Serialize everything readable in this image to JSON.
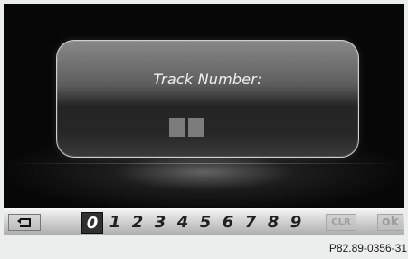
{
  "dialog": {
    "title": "Track Number:"
  },
  "keypad": {
    "selected_digit": "0",
    "digits": [
      "0",
      "1",
      "2",
      "3",
      "4",
      "5",
      "6",
      "7",
      "8",
      "9"
    ],
    "clear_label": "CLR",
    "ok_label": "ok"
  },
  "back_icon": "back-arrow-icon",
  "figure_code": "P82.89-0356-31",
  "colors": {
    "screen_background": "#070707",
    "bottom_bar": "#d0d0d0",
    "selected_digit_background": "#2f2f2f",
    "disabled_text": "#9d9d9d"
  }
}
